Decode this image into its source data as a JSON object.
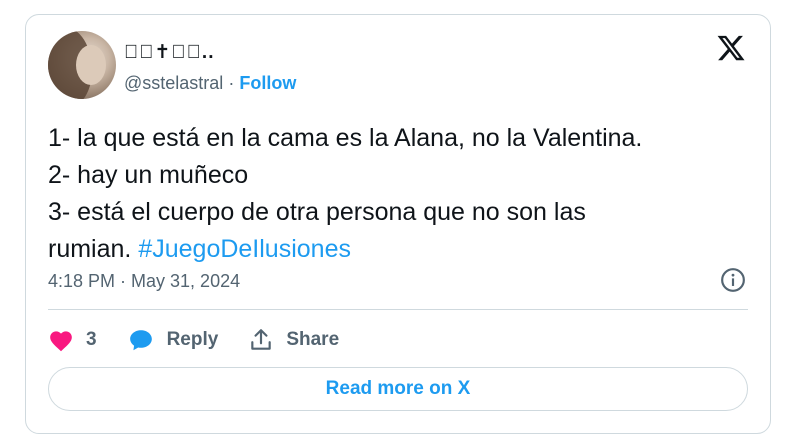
{
  "author": {
    "display_name": "􀀀􀀀✝︎􀀀􀀀..",
    "handle": "@sstelastral",
    "separator": "·",
    "follow_label": "Follow"
  },
  "tweet": {
    "lines": [
      "1- la que está en la cama es la Alana, no la Valentina.",
      "2- hay un muñeco",
      "3- está el cuerpo de otra persona que no son las",
      "rumian."
    ],
    "hashtag": "#JuegoDeIlusiones",
    "timestamp": "4:18 PM · May 31, 2024"
  },
  "actions": {
    "like_count": "3",
    "reply_label": "Reply",
    "share_label": "Share"
  },
  "read_more_label": "Read more on X",
  "colors": {
    "accent": "#1d9bf0",
    "like": "#f91880",
    "muted": "#536471",
    "text": "#0f1419",
    "border": "#cfd9de"
  },
  "icons": {
    "brand": "x-logo-icon",
    "info": "info-icon",
    "like": "heart-icon",
    "reply": "chat-bubble-icon",
    "share": "share-upload-icon"
  }
}
